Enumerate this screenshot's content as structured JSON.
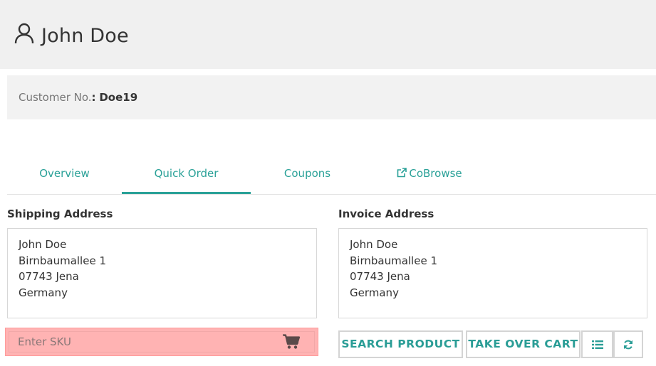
{
  "header": {
    "title": "John Doe",
    "icon": "user-icon"
  },
  "customer": {
    "label": "Customer No.",
    "separator": ":",
    "value": "Doe19"
  },
  "tabs": [
    {
      "label": "Overview",
      "active": false
    },
    {
      "label": "Quick Order",
      "active": true
    },
    {
      "label": "Coupons",
      "active": false
    },
    {
      "label": "CoBrowse",
      "active": false,
      "icon": "external-link-icon"
    }
  ],
  "shipping": {
    "title": "Shipping Address",
    "lines": [
      "John Doe",
      "Birnbaumallee 1",
      "07743 Jena",
      "Germany"
    ]
  },
  "invoice": {
    "title": "Invoice Address",
    "lines": [
      "John Doe",
      "Birnbaumallee 1",
      "07743 Jena",
      "Germany"
    ]
  },
  "sku": {
    "placeholder": "Enter SKU",
    "value": "",
    "icon": "shopping-cart-icon"
  },
  "actions": {
    "search_product": "SEARCH PRODUCT",
    "take_over_cart": "TAKE OVER CART",
    "list_icon": "list-icon",
    "refresh_icon": "refresh-icon"
  },
  "colors": {
    "accent": "#2aa198",
    "highlight": "#ffb3b3",
    "header_bg": "#f0f0f0"
  }
}
